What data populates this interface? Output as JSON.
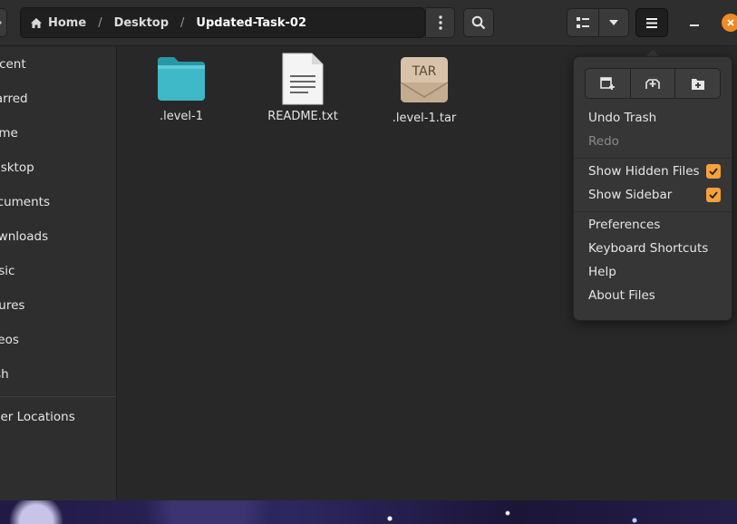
{
  "breadcrumb": {
    "items": [
      "Home",
      "Desktop",
      "Updated-Task-02"
    ]
  },
  "sidebar": {
    "items": [
      {
        "label": "Recent"
      },
      {
        "label": "Starred"
      },
      {
        "label": "Home"
      },
      {
        "label": "Desktop"
      },
      {
        "label": "Documents"
      },
      {
        "label": "Downloads"
      },
      {
        "label": "Music"
      },
      {
        "label": "Pictures"
      },
      {
        "label": "Videos"
      },
      {
        "label": "Trash"
      },
      {
        "label": "Other Locations"
      }
    ]
  },
  "files": [
    {
      "name": ".level-1",
      "icon": "folder-icon"
    },
    {
      "name": "README.txt",
      "icon": "text-file-icon"
    },
    {
      "name": ".level-1.tar",
      "icon": "archive-icon",
      "badge": "TAR"
    }
  ],
  "menu": {
    "items": [
      {
        "label": "Undo Trash",
        "enabled": true
      },
      {
        "label": "Redo",
        "enabled": false
      },
      {
        "label": "Show Hidden Files",
        "checked": true
      },
      {
        "label": "Show Sidebar",
        "checked": true
      },
      {
        "label": "Preferences"
      },
      {
        "label": "Keyboard Shortcuts"
      },
      {
        "label": "Help"
      },
      {
        "label": "About Files"
      }
    ]
  },
  "colors": {
    "accent": "#f6a13a",
    "folder": "#3fb8c8",
    "close": "#f08a24"
  }
}
